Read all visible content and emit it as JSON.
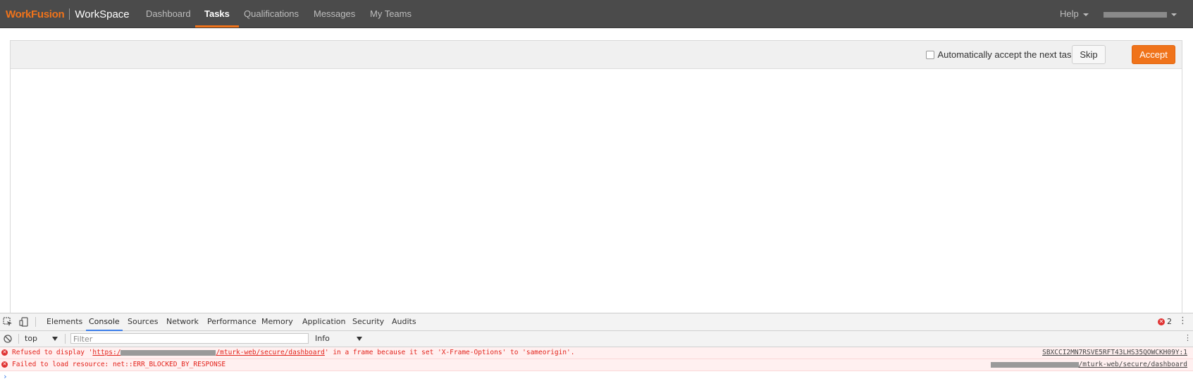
{
  "header": {
    "brand_logo": "WorkFusion",
    "brand_product": "WorkSpace",
    "nav": [
      {
        "label": "Dashboard",
        "active": false
      },
      {
        "label": "Tasks",
        "active": true
      },
      {
        "label": "Qualifications",
        "active": false
      },
      {
        "label": "Messages",
        "active": false
      },
      {
        "label": "My Teams",
        "active": false
      }
    ],
    "help_label": "Help"
  },
  "task_panel": {
    "auto_accept_label": "Automatically accept the next task",
    "auto_accept_checked": false,
    "skip_label": "Skip",
    "accept_label": "Accept"
  },
  "devtools": {
    "tabs": [
      "Elements",
      "Console",
      "Sources",
      "Network",
      "Performance",
      "Memory",
      "Application",
      "Security",
      "Audits"
    ],
    "active_tab": "Console",
    "error_count": "2",
    "context": "top",
    "filter_placeholder": "Filter",
    "level": "Info",
    "messages": [
      {
        "prefix": "Refused to display '",
        "url_start": "https:/",
        "url_end": "/mturk-web/secure/dashboard",
        "suffix": "' in a frame because it set 'X-Frame-Options' to 'sameorigin'.",
        "source": "SBXCCI2MN7RSVE5RFT43LHS35QOWCKH09Y:1"
      },
      {
        "text": "Failed to load resource: net::ERR_BLOCKED_BY_RESPONSE",
        "source": "/mturk-web/secure/dashboard"
      }
    ],
    "prompt": "›"
  },
  "colors": {
    "brand_orange": "#f0731a",
    "navbar_bg": "#4b4b4b",
    "error_red": "#e3231c",
    "devtools_blue": "#3b7de9"
  }
}
